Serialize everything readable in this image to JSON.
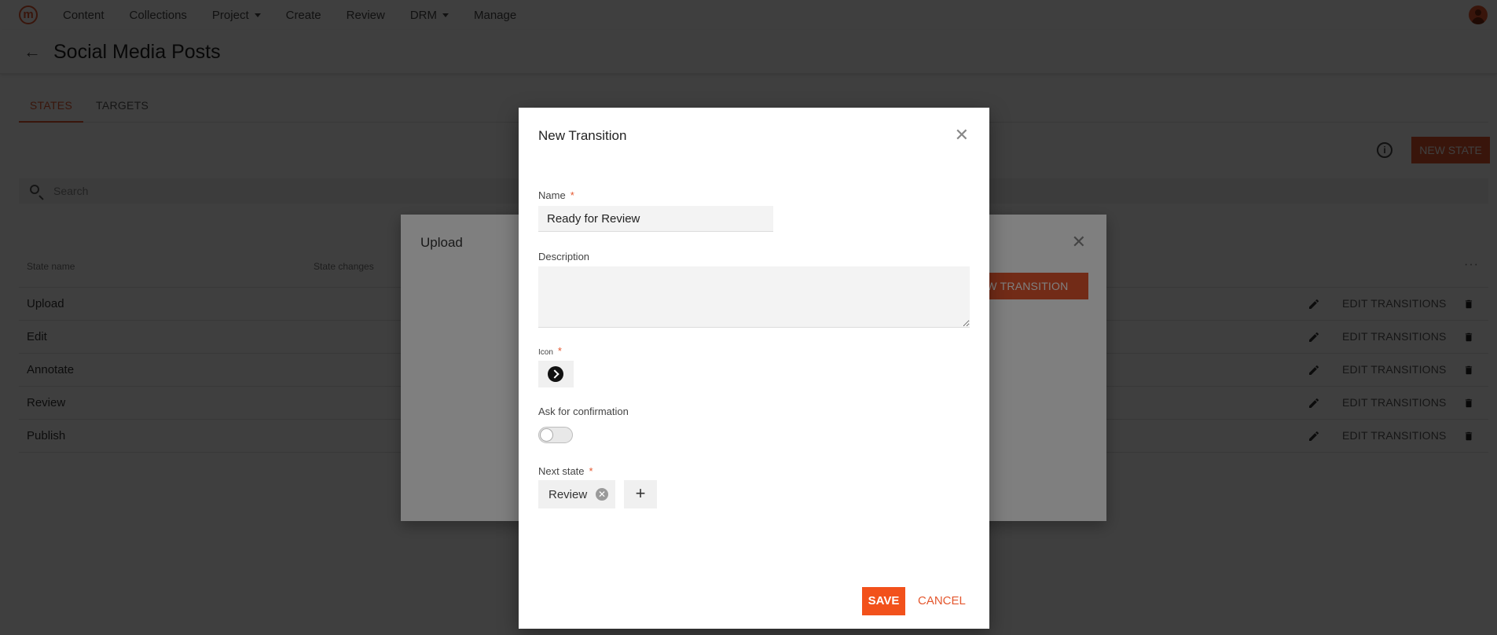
{
  "nav": {
    "items": [
      {
        "label": "Content",
        "dropdown": false
      },
      {
        "label": "Collections",
        "dropdown": false
      },
      {
        "label": "Project",
        "dropdown": true
      },
      {
        "label": "Create",
        "dropdown": false
      },
      {
        "label": "Review",
        "dropdown": false
      },
      {
        "label": "DRM",
        "dropdown": true
      },
      {
        "label": "Manage",
        "dropdown": false
      }
    ]
  },
  "icons": {
    "logo": "m",
    "back": "←",
    "info": "i",
    "close": "✕",
    "more": "···",
    "chip_remove": "✕",
    "add": "+"
  },
  "page": {
    "title": "Social Media Posts",
    "tabs": [
      "STATES",
      "TARGETS"
    ],
    "new_state_label": "NEW STATE",
    "search_placeholder": "Search"
  },
  "table": {
    "columns": [
      "State name",
      "State changes"
    ],
    "rows": [
      {
        "name": "Upload",
        "action": "EDIT TRANSITIONS"
      },
      {
        "name": "Edit",
        "action": "EDIT TRANSITIONS"
      },
      {
        "name": "Annotate",
        "action": "EDIT TRANSITIONS"
      },
      {
        "name": "Review",
        "action": "EDIT TRANSITIONS"
      },
      {
        "name": "Publish",
        "action": "EDIT TRANSITIONS"
      }
    ]
  },
  "upload_dialog": {
    "title": "Upload",
    "new_transition_label": "NEW TRANSITION"
  },
  "transition_dialog": {
    "title": "New Transition",
    "name_label": "Name",
    "name_value": "Ready for Review",
    "description_label": "Description",
    "description_value": "",
    "icon_label": "Icon",
    "icon_name": "arrow-circle-right-icon",
    "confirm_label": "Ask for confirmation",
    "confirm_enabled": false,
    "next_state_label": "Next state",
    "next_state_chip": "Review",
    "save_label": "SAVE",
    "cancel_label": "CANCEL",
    "required_marker": "*"
  },
  "colors": {
    "accent": "#e4572e",
    "save": "#f2511b"
  }
}
